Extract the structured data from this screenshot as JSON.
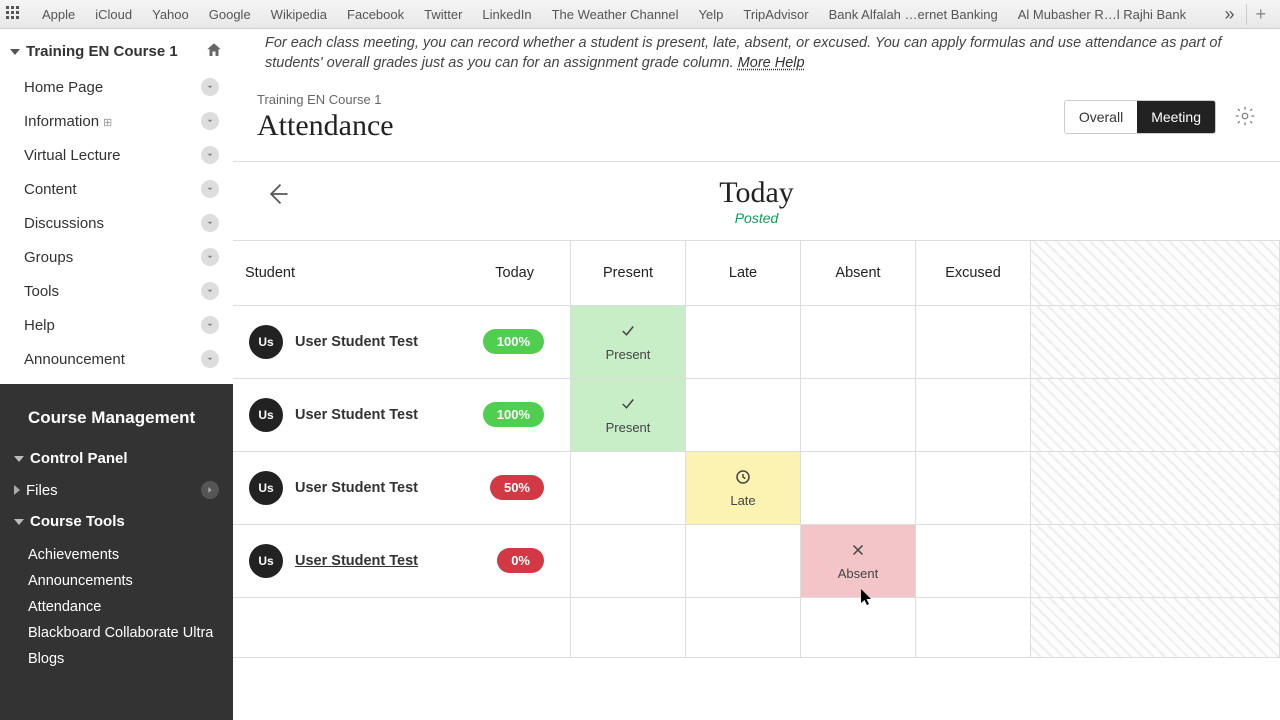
{
  "bookmarks": [
    "Apple",
    "iCloud",
    "Yahoo",
    "Google",
    "Wikipedia",
    "Facebook",
    "Twitter",
    "LinkedIn",
    "The Weather Channel",
    "Yelp",
    "TripAdvisor",
    "Bank Alfalah …ernet Banking",
    "Al Mubasher R…l Rajhi Bank"
  ],
  "bookmark_more": "»",
  "bookmark_add": "+",
  "sidebar": {
    "course_title": "Training EN Course 1",
    "nav": [
      {
        "label": "Home Page"
      },
      {
        "label": "Information",
        "icon": "⊞"
      },
      {
        "label": "Virtual Lecture"
      },
      {
        "label": "Content"
      },
      {
        "label": "Discussions"
      },
      {
        "label": "Groups"
      },
      {
        "label": "Tools"
      },
      {
        "label": "Help"
      },
      {
        "label": "Announcement"
      }
    ],
    "course_mgmt": "Course Management",
    "control_panel": "Control Panel",
    "files": "Files",
    "course_tools": "Course Tools",
    "tools": [
      "Achievements",
      "Announcements",
      "Attendance",
      "Blackboard Collaborate Ultra",
      "Blogs"
    ]
  },
  "intro": {
    "text": "For each class meeting, you can record whether a student is present, late, absent, or excused. You can apply formulas and use attendance as part of students' overall grades just as you can for an assignment grade column. ",
    "help": "More Help"
  },
  "header": {
    "breadcrumb": "Training EN Course 1",
    "title": "Attendance",
    "toggle": {
      "overall": "Overall",
      "meeting": "Meeting"
    }
  },
  "datebar": {
    "today": "Today",
    "posted": "Posted"
  },
  "columns": [
    "Student",
    "Today",
    "Present",
    "Late",
    "Absent",
    "Excused"
  ],
  "rows": [
    {
      "avatar": "Us",
      "name": "User Student Test",
      "score": "100%",
      "scoreColor": "green",
      "status": "present",
      "statusLabel": "Present"
    },
    {
      "avatar": "Us",
      "name": "User Student Test",
      "score": "100%",
      "scoreColor": "green",
      "status": "present",
      "statusLabel": "Present"
    },
    {
      "avatar": "Us",
      "name": "User Student Test",
      "score": "50%",
      "scoreColor": "red",
      "status": "late",
      "statusLabel": "Late"
    },
    {
      "avatar": "Us",
      "name": "User Student Test",
      "score": "0%",
      "scoreColor": "red",
      "status": "absent",
      "statusLabel": "Absent",
      "underline": true
    }
  ]
}
